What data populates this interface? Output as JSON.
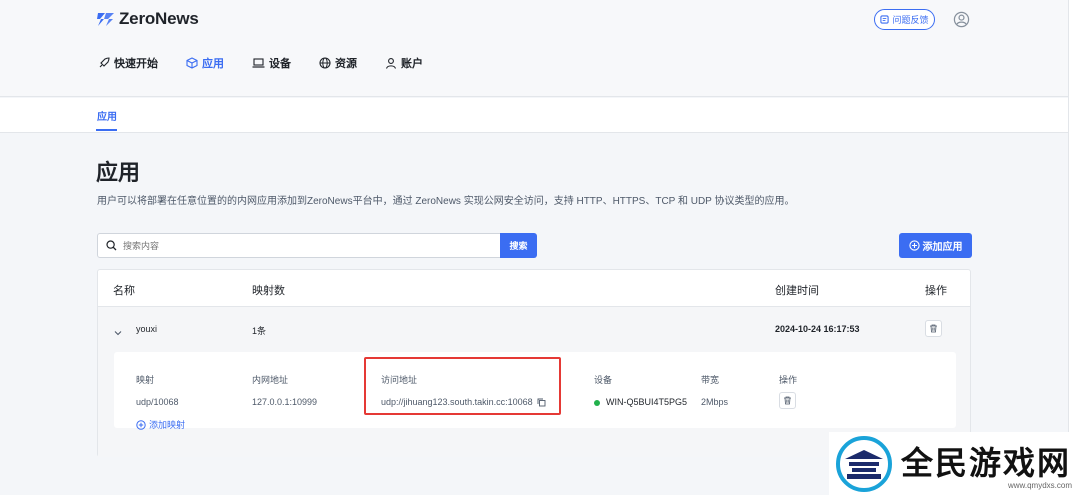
{
  "header": {
    "logo_text": "ZeroNews",
    "feedback_label": "问题反馈"
  },
  "nav": [
    {
      "label": "快速开始",
      "icon": "rocket-icon",
      "active": false
    },
    {
      "label": "应用",
      "icon": "cube-icon",
      "active": true
    },
    {
      "label": "设备",
      "icon": "laptop-icon",
      "active": false
    },
    {
      "label": "资源",
      "icon": "globe-icon",
      "active": false
    },
    {
      "label": "账户",
      "icon": "user-icon",
      "active": false
    }
  ],
  "subnav": {
    "tab": "应用"
  },
  "page": {
    "title": "应用",
    "description": "用户可以将部署在任意位置的的内网应用添加到ZeroNews平台中，通过 ZeroNews 实现公网安全访问，支持 HTTP、HTTPS、TCP 和 UDP 协议类型的应用。"
  },
  "search": {
    "placeholder": "搜索内容",
    "button": "搜索"
  },
  "add_app_button": "添加应用",
  "table": {
    "headers": {
      "name": "名称",
      "mappings": "映射数",
      "created": "创建时间",
      "action": "操作"
    },
    "rows": [
      {
        "name": "youxi",
        "mappings": "1条",
        "created": "2024-10-24 16:17:53"
      }
    ]
  },
  "mapping_detail": {
    "headers": {
      "mapping": "映射",
      "internal": "内网地址",
      "access": "访问地址",
      "device": "设备",
      "bandwidth": "带宽",
      "action": "操作"
    },
    "row": {
      "mapping": "udp/10068",
      "internal": "127.0.0.1:10999",
      "access": "udp://jihuang123.south.takin.cc:10068",
      "device": "WIN-Q5BUI4T5PG5",
      "bandwidth": "2Mbps"
    },
    "add_mapping": "添加映射"
  },
  "watermark": {
    "text": "全民游戏网",
    "url": "www.qmydxs.com"
  },
  "colors": {
    "primary": "#3b6df2",
    "highlight": "#e53935",
    "online": "#22b14c"
  }
}
